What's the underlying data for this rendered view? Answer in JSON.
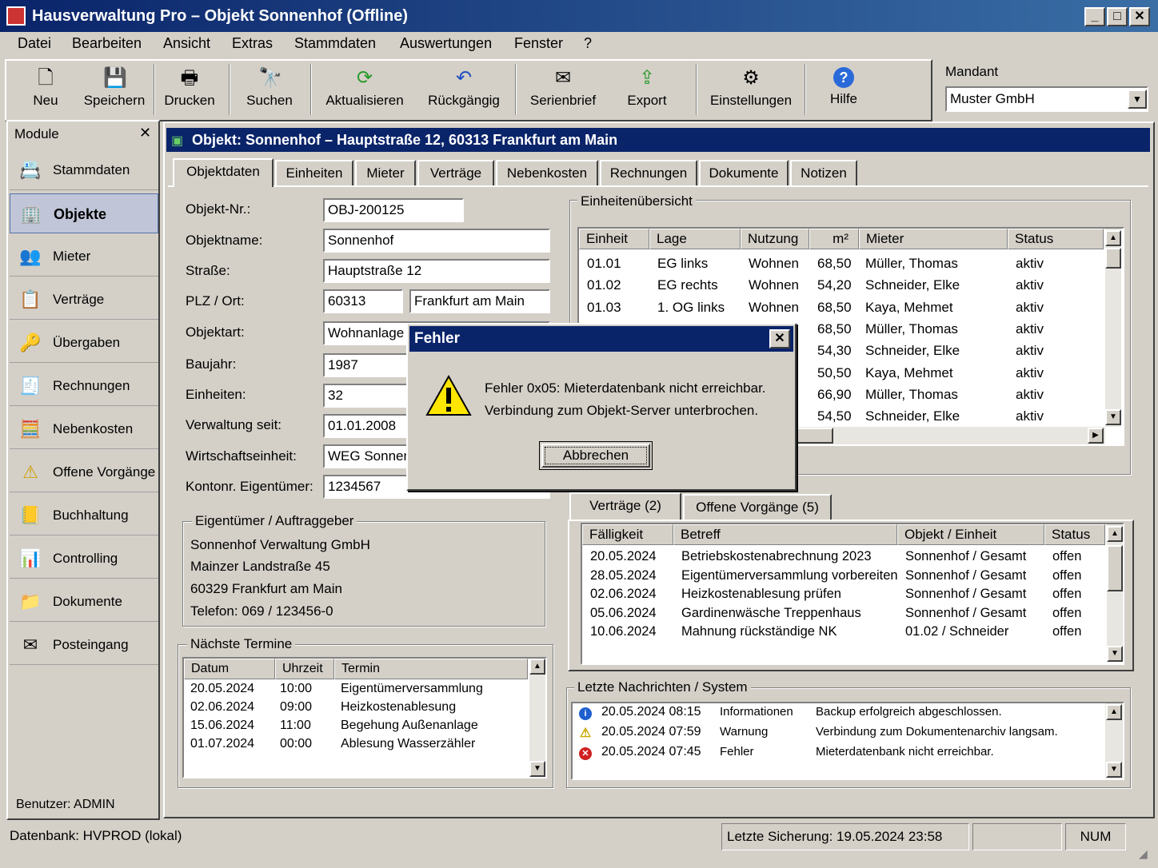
{
  "window": {
    "title": "Hausverwaltung Pro – Objekt Sonnenhof (Offline)"
  },
  "menu": [
    "Datei",
    "Bearbeiten",
    "Ansicht",
    "Extras",
    "Stammdaten",
    "Auswertungen",
    "Fenster",
    "?"
  ],
  "toolbar": {
    "buttons": [
      {
        "label": "Neu",
        "icon": "new-document-icon"
      },
      {
        "label": "Speichern",
        "icon": "save-disk-icon"
      },
      {
        "label": "Drucken",
        "icon": "printer-icon"
      },
      {
        "label": "Suchen",
        "icon": "binoculars-icon"
      },
      {
        "label": "Aktualisieren",
        "icon": "refresh-icon"
      },
      {
        "label": "Rückgängig",
        "icon": "undo-icon"
      },
      {
        "label": "Serienbrief",
        "icon": "mail-merge-icon"
      },
      {
        "label": "Export",
        "icon": "export-icon"
      },
      {
        "label": "Einstellungen",
        "icon": "settings-icon"
      },
      {
        "label": "Hilfe",
        "icon": "help-icon"
      }
    ],
    "mandant_label": "Mandant",
    "mandant_value": "Muster GmbH"
  },
  "modules": {
    "title": "Module",
    "items": [
      {
        "label": "Stammdaten",
        "icon": "master-data-icon"
      },
      {
        "label": "Objekte",
        "icon": "buildings-icon",
        "selected": true
      },
      {
        "label": "Mieter",
        "icon": "tenant-icon"
      },
      {
        "label": "Verträge",
        "icon": "contract-icon"
      },
      {
        "label": "Übergaben",
        "icon": "handover-icon"
      },
      {
        "label": "Rechnungen",
        "icon": "invoice-icon"
      },
      {
        "label": "Nebenkosten",
        "icon": "calculator-icon"
      },
      {
        "label": "Offene Vorgänge",
        "icon": "warning-icon"
      },
      {
        "label": "Buchhaltung",
        "icon": "accounting-icon"
      },
      {
        "label": "Controlling",
        "icon": "bar-chart-icon"
      },
      {
        "label": "Dokumente",
        "icon": "folder-icon"
      },
      {
        "label": "Posteingang",
        "icon": "envelope-icon"
      }
    ],
    "user": "Benutzer: ADMIN"
  },
  "object": {
    "header": "Objekt: Sonnenhof – Hauptstraße 12,  60313 Frankfurt am Main",
    "tabs": [
      "Objektdaten",
      "Einheiten",
      "Mieter",
      "Verträge",
      "Nebenkosten",
      "Rechnungen",
      "Dokumente",
      "Notizen"
    ],
    "fields": {
      "objnr_label": "Objekt-Nr.:",
      "objnr": "OBJ-200125",
      "name_label": "Objektname:",
      "name": "Sonnenhof",
      "street_label": "Straße:",
      "street": "Hauptstraße 12",
      "plz_label": "PLZ / Ort:",
      "plz": "60313",
      "city": "Frankfurt am Main",
      "type_label": "Objektart:",
      "type": "Wohnanlage",
      "year_label": "Baujahr:",
      "year": "1987",
      "units_label": "Einheiten:",
      "units": "32",
      "since_label": "Verwaltung seit:",
      "since": "01.01.2008",
      "weg_label": "Wirtschaftseinheit:",
      "weg": "WEG Sonnenhof",
      "konto_label": "Kontonr. Eigentümer:",
      "konto": "1234567"
    },
    "owner": {
      "title": "Eigentümer / Auftraggeber",
      "lines": [
        "Sonnenhof Verwaltung GmbH",
        "Mainzer Landstraße 45",
        "60329 Frankfurt am Main",
        "Telefon:  069 / 123456-0"
      ]
    },
    "termine": {
      "title": "Nächste Termine",
      "columns": [
        "Datum",
        "Uhrzeit",
        "Termin"
      ],
      "rows": [
        [
          "20.05.2024",
          "10:00",
          "Eigentümerversammlung"
        ],
        [
          "02.06.2024",
          "09:00",
          "Heizkostenablesung"
        ],
        [
          "15.06.2024",
          "11:00",
          "Begehung Außenanlage"
        ],
        [
          "01.07.2024",
          "00:00",
          "Ablesung Wasserzähler"
        ]
      ]
    },
    "units_overview": {
      "title": "Einheitenübersicht",
      "columns": [
        "Einheit",
        "Lage",
        "Nutzung",
        "m²",
        "Mieter",
        "Status"
      ],
      "rows": [
        [
          "01.01",
          "EG links",
          "Wohnen",
          "68,50",
          "Müller, Thomas",
          "aktiv"
        ],
        [
          "01.02",
          "EG rechts",
          "Wohnen",
          "54,20",
          "Schneider, Elke",
          "aktiv"
        ],
        [
          "01.03",
          "1. OG links",
          "Wohnen",
          "68,50",
          "Kaya, Mehmet",
          "aktiv"
        ],
        [
          "",
          "",
          "",
          "68,50",
          "Müller, Thomas",
          "aktiv"
        ],
        [
          "",
          "",
          "",
          "54,30",
          "Schneider, Elke",
          "aktiv"
        ],
        [
          "",
          "",
          "",
          "50,50",
          "Kaya, Mehmet",
          "aktiv"
        ],
        [
          "",
          "",
          "",
          "66,90",
          "Müller, Thomas",
          "aktiv"
        ],
        [
          "",
          "",
          "",
          "54,50",
          "Schneider, Elke",
          "aktiv"
        ]
      ]
    },
    "sub_tabs": [
      "Verträge (2)",
      "Offene Vorgänge  (5)"
    ],
    "vorgaenge": {
      "columns": [
        "Fälligkeit",
        "Betreff",
        "Objekt / Einheit",
        "Status"
      ],
      "rows": [
        [
          "20.05.2024",
          "Betriebskostenabrechnung 2023",
          "Sonnenhof / Gesamt",
          "offen"
        ],
        [
          "28.05.2024",
          "Eigentümerversammlung vorbereiten",
          "Sonnenhof / Gesamt",
          "offen"
        ],
        [
          "02.06.2024",
          "Heizkostenablesung prüfen",
          "Sonnenhof / Gesamt",
          "offen"
        ],
        [
          "05.06.2024",
          "Gardinenwäsche Treppenhaus",
          "Sonnenhof / Gesamt",
          "offen"
        ],
        [
          "10.06.2024",
          "Mahnung rückständige NK",
          "01.02 / Schneider",
          "offen"
        ]
      ]
    },
    "messages": {
      "title": "Letzte Nachrichten / System",
      "rows": [
        {
          "icon": "info-icon",
          "time": "20.05.2024 08:15",
          "type": "Informationen",
          "text": "Backup erfolgreich abgeschlossen.",
          "color": "#1f5fd0"
        },
        {
          "icon": "warning-icon",
          "time": "20.05.2024 07:59",
          "type": "Warnung",
          "text": "Verbindung zum Dokumentenarchiv langsam.",
          "color": "#e8c800"
        },
        {
          "icon": "error-icon",
          "time": "20.05.2024 07:45",
          "type": "Fehler",
          "text": "Mieterdatenbank nicht erreichbar.",
          "color": "#d02020"
        }
      ]
    }
  },
  "dialog": {
    "title": "Fehler",
    "line1": "Fehler 0x05: Mieterdatenbank nicht erreichbar.",
    "line2": "Verbindung zum Objekt-Server unterbrochen.",
    "button": "Abbrechen"
  },
  "status": {
    "db": "Datenbank: HVPROD (lokal)",
    "backup": "Letzte Sicherung: 19.05.2024 23:58",
    "num": "NUM"
  }
}
